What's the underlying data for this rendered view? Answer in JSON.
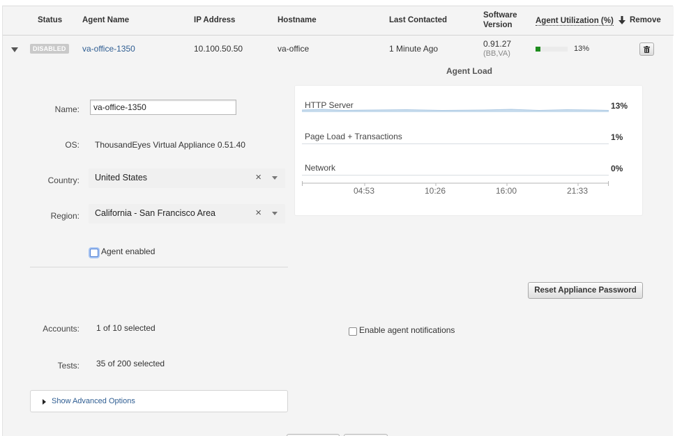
{
  "table": {
    "headers": {
      "status": "Status",
      "agent_name": "Agent Name",
      "ip_address": "IP Address",
      "hostname": "Hostname",
      "last_contacted": "Last Contacted",
      "software_version_line1": "Software",
      "software_version_line2": "Version",
      "agent_utilization": "Agent Utilization (%)",
      "remove": "Remove"
    },
    "row": {
      "status_badge": "DISABLED",
      "agent_name": "va-office-1350",
      "ip_address": "10.100.50.50",
      "hostname": "va-office",
      "last_contacted": "1 Minute Ago",
      "software_version": "0.91.27",
      "software_version_sub": "(BB,VA)",
      "utilization_percent": 13,
      "utilization_label": "13%"
    }
  },
  "details": {
    "name_label": "Name:",
    "name_value": "va-office-1350",
    "os_label": "OS:",
    "os_value": "ThousandEyes Virtual Appliance 0.51.40",
    "country_label": "Country:",
    "country_value": "United States",
    "region_label": "Region:",
    "region_value": "California - San Francisco Area",
    "clear_glyph": "×",
    "agent_enabled_label": "Agent enabled",
    "agent_enabled_checked": false,
    "accounts_label": "Accounts:",
    "accounts_value": "1 of 10 selected",
    "tests_label": "Tests:",
    "tests_value": "35 of 200 selected",
    "enable_notifications_label": "Enable agent notifications",
    "reset_password_button": "Reset Appliance Password",
    "advanced_options_link": "Show Advanced Options"
  },
  "agent_load": {
    "title": "Agent Load",
    "metrics": [
      {
        "label": "HTTP Server",
        "value": "13%"
      },
      {
        "label": "Page Load + Transactions",
        "value": "1%"
      },
      {
        "label": "Network",
        "value": "0%"
      }
    ],
    "time_ticks": [
      "04:53",
      "10:26",
      "16:00",
      "21:33"
    ]
  },
  "icons": {
    "expand": "chevron-down-icon",
    "sort": "sort-down-arrow-icon",
    "remove": "trash-icon",
    "advanced": "caret-right-icon"
  },
  "colors": {
    "link": "#2e5d92",
    "utilization_fill": "#1e8c1e",
    "badge_bg": "#c9c9c9",
    "focus_ring": "#a9c5f2"
  }
}
